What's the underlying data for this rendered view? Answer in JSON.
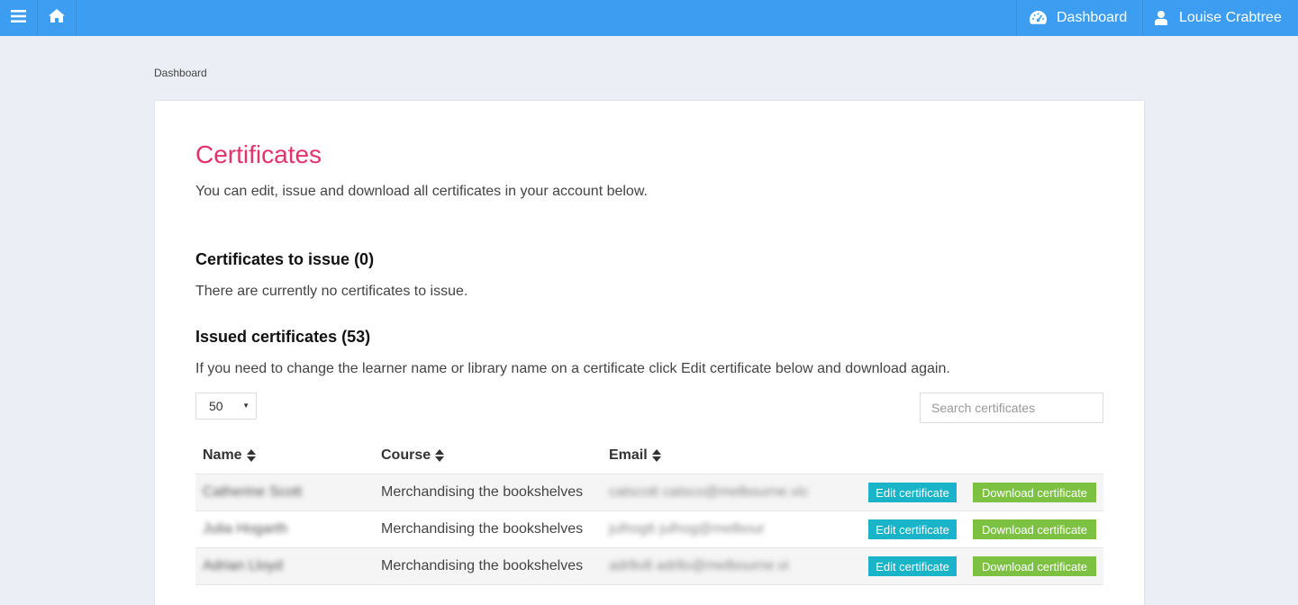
{
  "topbar": {
    "menu_icon": "hamburger-menu-icon",
    "home_icon": "home-icon",
    "dashboard_label": "Dashboard",
    "dashboard_icon": "speedometer-icon",
    "user_label": "Louise Crabtree",
    "user_icon": "user-icon",
    "bar_color": "#3d9df0"
  },
  "breadcrumb": "Dashboard",
  "page": {
    "title": "Certificates",
    "intro": "You can edit, issue and download all certificates in your account below.",
    "to_issue_heading": "Certificates to issue (0)",
    "to_issue_text": "There are currently no certificates to issue.",
    "issued_heading": "Issued certificates (53)",
    "issued_help": "If you need to change the learner name or library name on a certificate click Edit certificate below and download again."
  },
  "controls": {
    "page_size": "50",
    "search_placeholder": "Search certificates"
  },
  "table": {
    "headers": {
      "name": "Name",
      "course": "Course",
      "email": "Email"
    },
    "sort_icon": "sort-arrows-icon",
    "rows": [
      {
        "name": "Catherine Scott",
        "course": "Merchandising the bookshelves",
        "email": "catscott catsco@melbourne.vic",
        "edit": "Edit certificate",
        "download": "Download certificate"
      },
      {
        "name": "Julia Hogarth",
        "course": "Merchandising the bookshelves",
        "email": "julhog6 julhog@melbour",
        "edit": "Edit certificate",
        "download": "Download certificate"
      },
      {
        "name": "Adrian Lloyd",
        "course": "Merchandising the bookshelves",
        "email": "adrllo8 adrllo@melbourne.vi",
        "edit": "Edit certificate",
        "download": "Download certificate"
      }
    ]
  },
  "colors": {
    "title": "#e4326b",
    "edit_button": "#1ab4c8",
    "download_button": "#7dc142"
  }
}
